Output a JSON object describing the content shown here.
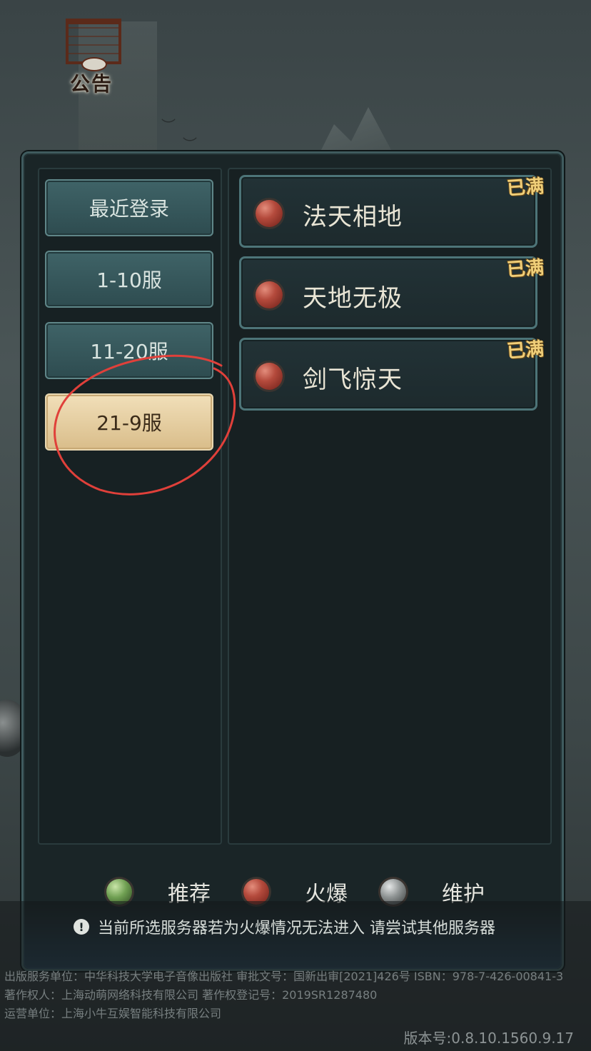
{
  "notice": {
    "label": "公告"
  },
  "tabs": [
    {
      "label": "最近登录",
      "active": false
    },
    {
      "label": "1-10服",
      "active": false
    },
    {
      "label": "11-20服",
      "active": false
    },
    {
      "label": "21-9服",
      "active": true
    }
  ],
  "servers": [
    {
      "name": "法天相地",
      "status": "火爆",
      "tag": "已满"
    },
    {
      "name": "天地无极",
      "status": "火爆",
      "tag": "已满"
    },
    {
      "name": "剑飞惊天",
      "status": "火爆",
      "tag": "已满"
    }
  ],
  "legend": [
    {
      "label": "推荐",
      "color": "#6f9f52"
    },
    {
      "label": "火爆",
      "color": "#b44a3c"
    },
    {
      "label": "维护",
      "color": "#8d9292"
    }
  ],
  "hint": "当前所选服务器若为火爆情况无法进入 请尝试其他服务器",
  "footer": {
    "line1": "出版服务单位：中华科技大学电子音像出版社 审批文号：国新出审[2021]426号 ISBN：978-7-426-00841-3",
    "line2": "著作权人：上海动萌网络科技有限公司 著作权登记号：2019SR1287480",
    "line3": "运营单位：上海小牛互娱智能科技有限公司",
    "version": "版本号:0.8.10.1560.9.17"
  },
  "colors": {
    "accent_gold": "#f0cf79",
    "active_tab": "#e8d7b0",
    "panel_border": "#3f5b5e",
    "annotation_red": "#e0403a"
  }
}
